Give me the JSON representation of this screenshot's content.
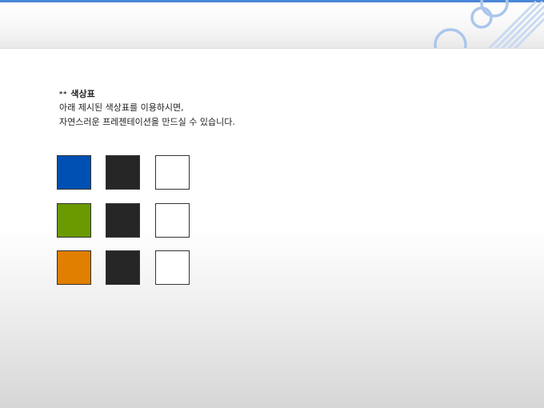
{
  "slide": {
    "heading_bullets": "**",
    "heading": "색상표",
    "desc_line1": "아래 제시된 색상표를 이용하시면,",
    "desc_line2": "자연스러운 프레젠테이션을 만드실 수 있습니다."
  },
  "theme": {
    "accent": "#4a86d8",
    "deco_circle": "#aac6ec",
    "deco_stripe": "#c9daf1"
  },
  "palette": {
    "rows": [
      [
        "#0050b3",
        "#262626",
        "#ffffff"
      ],
      [
        "#6a9a00",
        "#262626",
        "#ffffff"
      ],
      [
        "#e07f00",
        "#262626",
        "#ffffff"
      ]
    ]
  }
}
